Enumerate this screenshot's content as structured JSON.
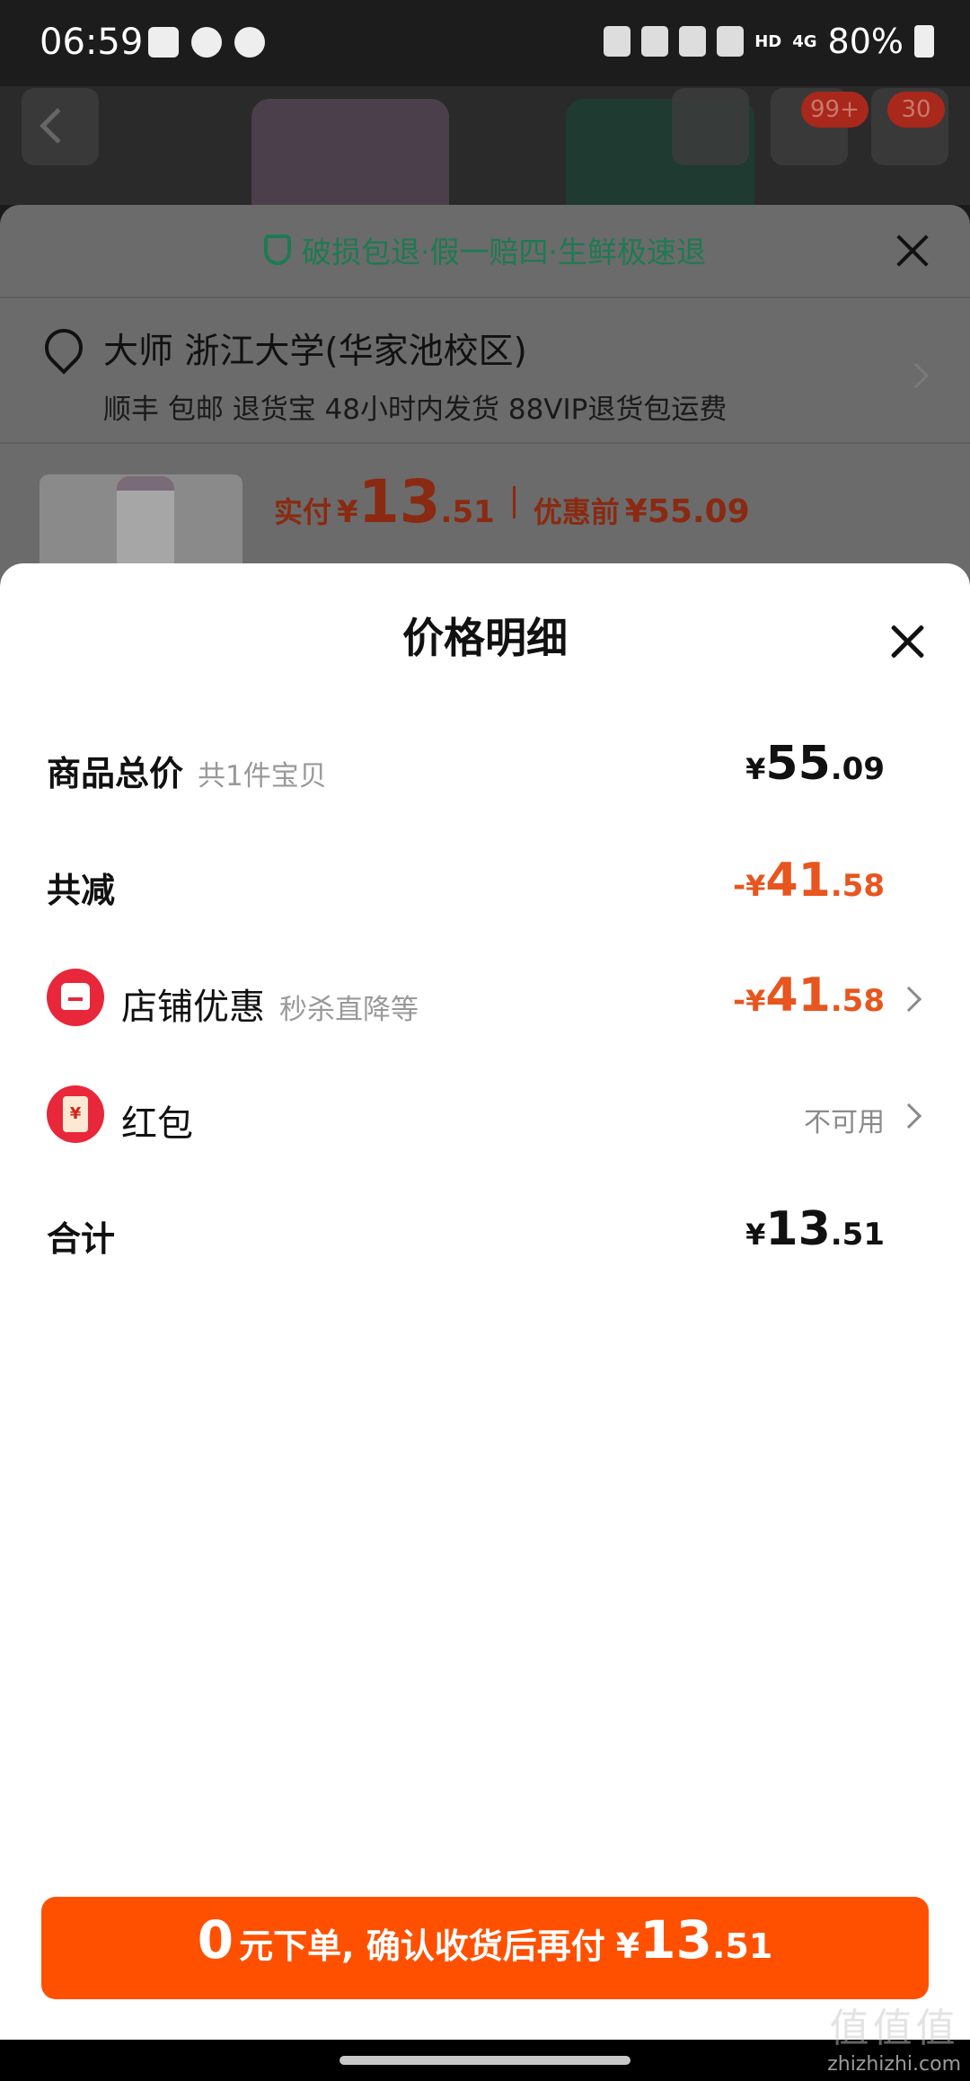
{
  "status_bar": {
    "time": "06:59",
    "network": "HD",
    "signal": "4G",
    "battery": "80%"
  },
  "top_nav": {
    "cart_badge": "99+",
    "more_badge": "30"
  },
  "background_sheet": {
    "guarantee": "破损包退·假一赔四·生鲜极速退",
    "address_name": "大师 浙江大学(华家池校区)",
    "shipping_info": "顺丰 包邮 退货宝 48小时内发货 88VIP退货包运费",
    "paid_label": "实付",
    "paid_yen": "¥",
    "paid_int": "13",
    "paid_dec": ".51",
    "pre_label": "优惠前",
    "pre_value": "¥55.09"
  },
  "modal": {
    "title": "价格明细",
    "rows": {
      "total": {
        "label": "商品总价",
        "sub": "共1件宝贝",
        "yen": "¥",
        "int": "55",
        "dec": ".09"
      },
      "reduce": {
        "label": "共减",
        "sign": "-",
        "yen": "¥",
        "int": "41",
        "dec": ".58"
      },
      "store": {
        "label": "店铺优惠",
        "sub": "秒杀直降等",
        "sign": "-",
        "yen": "¥",
        "int": "41",
        "dec": ".58",
        "icon": "store-icon"
      },
      "redpacket": {
        "label": "红包",
        "status": "不可用",
        "icon": "red-envelope-icon",
        "icon_glyph": "¥"
      },
      "sum": {
        "label": "合计",
        "yen": "¥",
        "int": "13",
        "dec": ".51"
      }
    }
  },
  "cta": {
    "zero": "0",
    "text": "元下单, 确认收货后再付",
    "yen": "¥",
    "int": "13",
    "dec": ".51"
  },
  "watermark": {
    "text": "zhizhizhi.com",
    "glyph": "值值值"
  },
  "colors": {
    "accent": "#ff5000",
    "discount": "#e8551e",
    "guarantee_green": "#1e7a52"
  }
}
